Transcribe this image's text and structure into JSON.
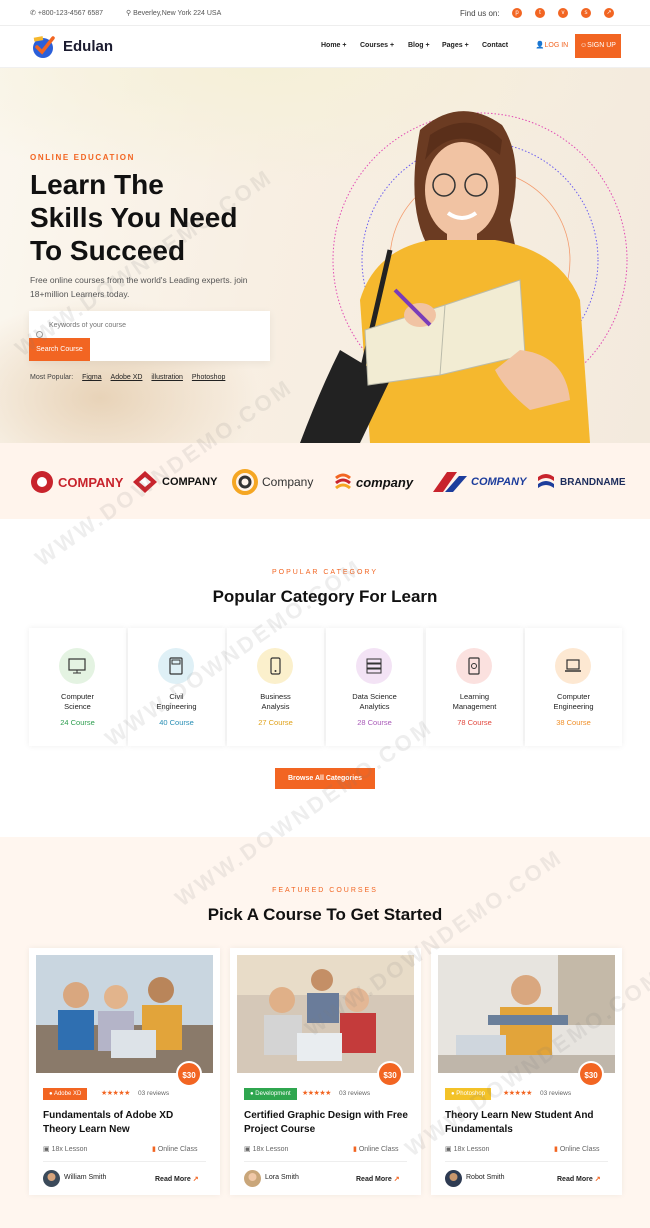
{
  "topbar": {
    "phone": "+800-123-4567 6587",
    "address": "Beverley,New York 224 USA",
    "find_us": "Find us on:",
    "social_icons": [
      "pinterest-icon",
      "twitter-icon",
      "vimeo-icon",
      "skype-icon",
      "share-icon"
    ]
  },
  "nav": {
    "brand": "Edulan",
    "items": [
      "Home",
      "Courses",
      "Blog",
      "Pages",
      "Contact"
    ],
    "login": "LOG IN",
    "signup": "SIGN UP"
  },
  "hero": {
    "eyebrow": "ONLINE EDUCATION",
    "title_line1": "Learn The",
    "title_line2": "Skills You Need",
    "title_line3": "To Succeed",
    "subtitle": "Free online courses from the world's Leading experts. join 18+million Learners today.",
    "search_placeholder": "Keywords of your course",
    "search_button": "Search Course",
    "popular_label": "Most Popular:",
    "popular_tags": [
      "Figma",
      "Adobe XD",
      "illustration",
      "Photoshop"
    ]
  },
  "brands": [
    "COMPANY",
    "COMPANY",
    "Company",
    "company",
    "COMPANY",
    "BRANDNAME"
  ],
  "categories": {
    "eyebrow": "POPULAR CATEGORY",
    "title": "Popular Category For Learn",
    "items": [
      {
        "name1": "Computer",
        "name2": "Science",
        "count": "24 Course",
        "color": "#2e9e4f",
        "bg": "#e4f3e2"
      },
      {
        "name1": "Civil",
        "name2": "Engineering",
        "count": "40 Course",
        "color": "#2a8fb5",
        "bg": "#dff0f6"
      },
      {
        "name1": "Business",
        "name2": "Analysis",
        "count": "27 Course",
        "color": "#e0a21a",
        "bg": "#fbf0cc"
      },
      {
        "name1": "Data Science",
        "name2": "Analytics",
        "count": "28 Course",
        "color": "#a95bb8",
        "bg": "#f3e3f5"
      },
      {
        "name1": "Learning",
        "name2": "Management",
        "count": "78 Course",
        "color": "#e2493f",
        "bg": "#fbe1df"
      },
      {
        "name1": "Computer",
        "name2": "Engineering",
        "count": "38 Course",
        "color": "#f0902a",
        "bg": "#fde8d2"
      }
    ],
    "browse_button": "Browse All Categories"
  },
  "courses": {
    "eyebrow": "FEATURED COURSES",
    "title": "Pick A Course To Get Started",
    "items": [
      {
        "price": "$30",
        "tag": "Adobe XD",
        "tag_color": "#f26522",
        "reviews": "03 reviews",
        "title": "Fundamentals of Adobe XD Theory Learn New",
        "lessons": "18x Lesson",
        "mode": "Online Class",
        "author": "William Smith",
        "read_more": "Read More"
      },
      {
        "price": "$30",
        "tag": "Development",
        "tag_color": "#2fa64f",
        "reviews": "03 reviews",
        "title": "Certified Graphic Design with Free Project Course",
        "lessons": "18x Lesson",
        "mode": "Online Class",
        "author": "Lora Smith",
        "read_more": "Read More"
      },
      {
        "price": "$30",
        "tag": "Photoshop",
        "tag_color": "#f3c228",
        "reviews": "03 reviews",
        "title": "Theory Learn New Student And Fundamentals",
        "lessons": "18x Lesson",
        "mode": "Online Class",
        "author": "Robot Smith",
        "read_more": "Read More"
      }
    ],
    "stars": "★★★★★"
  },
  "watermark": "WWW.DOWNDEMO.COM",
  "colors": {
    "accent": "#f26522",
    "dark": "#111111"
  }
}
